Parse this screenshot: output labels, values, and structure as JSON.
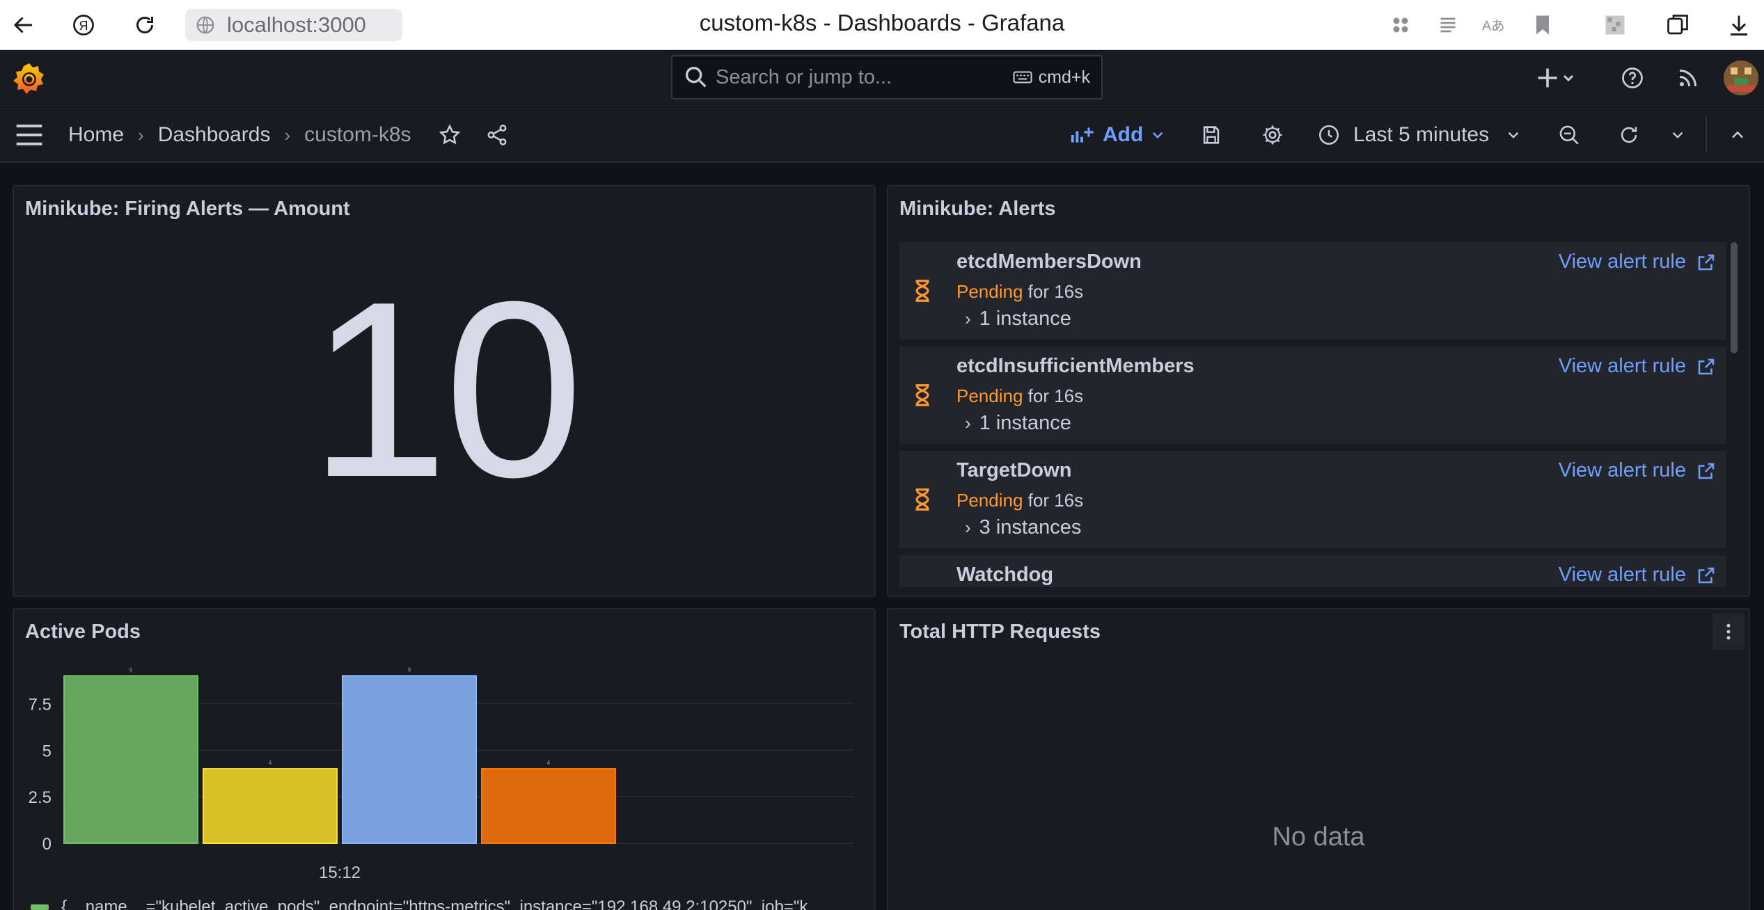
{
  "browser": {
    "url": "localhost:3000",
    "tab_title": "custom-k8s - Dashboards - Grafana"
  },
  "topnav": {
    "search_placeholder": "Search or jump to...",
    "search_shortcut": "cmd+k"
  },
  "breadcrumb": {
    "items": [
      "Home",
      "Dashboards",
      "custom-k8s"
    ]
  },
  "toolbar": {
    "add_label": "Add",
    "time_range": "Last 5 minutes"
  },
  "panels": {
    "firing_alerts": {
      "title": "Minikube: Firing Alerts — Amount",
      "value": "10"
    },
    "alerts": {
      "title": "Minikube: Alerts",
      "view_rule_label": "View alert rule",
      "items": [
        {
          "name": "etcdMembersDown",
          "state": "Pending",
          "duration": "for 16s",
          "instances": "1 instance"
        },
        {
          "name": "etcdInsufficientMembers",
          "state": "Pending",
          "duration": "for 16s",
          "instances": "1 instance"
        },
        {
          "name": "TargetDown",
          "state": "Pending",
          "duration": "for 16s",
          "instances": "3 instances"
        },
        {
          "name": "Watchdog",
          "state": "",
          "duration": "",
          "instances": ""
        }
      ]
    },
    "active_pods": {
      "title": "Active Pods",
      "legend": "{__name__=\"kubelet_active_pods\", endpoint=\"https-metrics\", instance=\"192.168.49.2:10250\", job=\"k"
    },
    "http_requests": {
      "title": "Total HTTP Requests",
      "empty_text": "No data"
    }
  },
  "chart_data": {
    "type": "bar",
    "categories": [
      "15:12"
    ],
    "series": [
      {
        "values": [
          9
        ],
        "color": "#73bf69"
      },
      {
        "values": [
          4
        ],
        "color": "#fade2a"
      },
      {
        "values": [
          9
        ],
        "color": "#8ab8ff"
      },
      {
        "values": [
          4
        ],
        "color": "#ff780a"
      }
    ],
    "data_labels": [
      "9",
      "4",
      "9",
      "4"
    ],
    "yticks": [
      "0",
      "2.5",
      "5",
      "7.5"
    ],
    "ylim": [
      0,
      9.5
    ],
    "xtick": "15:12",
    "grid": true
  },
  "colors": {
    "accent": "#6e9fff",
    "pending": "#ff9830",
    "panel_bg": "#181b1f",
    "page_bg": "#111217"
  }
}
